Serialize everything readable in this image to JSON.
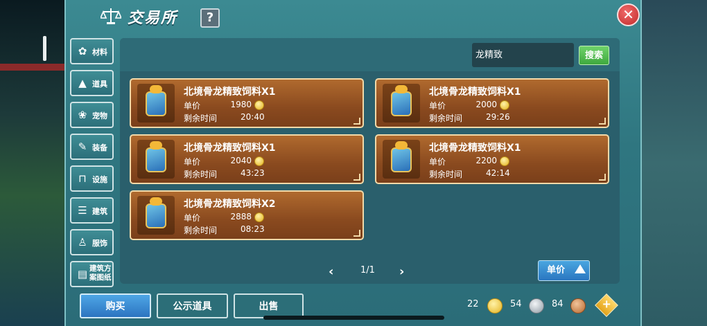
{
  "window": {
    "title": "交易所",
    "help_label": "?",
    "close_label": "✕"
  },
  "categories": [
    {
      "label": "材料",
      "icon": "materials-icon",
      "glyph": "✿"
    },
    {
      "label": "道具",
      "icon": "props-icon",
      "glyph": "▲"
    },
    {
      "label": "宠物",
      "icon": "pet-paw-icon",
      "glyph": "❀"
    },
    {
      "label": "装备",
      "icon": "equipment-icon",
      "glyph": "✎"
    },
    {
      "label": "设施",
      "icon": "facility-icon",
      "glyph": "⊓"
    },
    {
      "label": "建筑",
      "icon": "building-icon",
      "glyph": "☰"
    },
    {
      "label": "服饰",
      "icon": "clothing-icon",
      "glyph": "♙"
    },
    {
      "label": "建筑方案图纸",
      "icon": "blueprint-icon",
      "glyph": "▤"
    }
  ],
  "search": {
    "value": "龙精致",
    "button_label": "搜索"
  },
  "listings": [
    {
      "name": "北境骨龙精致饲料X1",
      "price_label": "单价",
      "price": "1980",
      "time_label": "剩余时间",
      "time": "20:40"
    },
    {
      "name": "北境骨龙精致饲料X1",
      "price_label": "单价",
      "price": "2000",
      "time_label": "剩余时间",
      "time": "29:26"
    },
    {
      "name": "北境骨龙精致饲料X1",
      "price_label": "单价",
      "price": "2040",
      "time_label": "剩余时间",
      "time": "43:23"
    },
    {
      "name": "北境骨龙精致饲料X1",
      "price_label": "单价",
      "price": "2200",
      "time_label": "剩余时间",
      "time": "42:14"
    },
    {
      "name": "北境骨龙精致饲料X2",
      "price_label": "单价",
      "price": "2888",
      "time_label": "剩余时间",
      "time": "08:23"
    }
  ],
  "pagination": {
    "label": "1/1",
    "prev": "‹",
    "next": "›"
  },
  "sort": {
    "label": "单价"
  },
  "bottom_tabs": {
    "buy": "购买",
    "public_items": "公示道具",
    "sell": "出售"
  },
  "currency": {
    "gold": "22",
    "silver": "54",
    "bronze": "84"
  },
  "colors": {
    "card": "#8a4a1f",
    "active_tab": "#2c74c0",
    "search_button": "#3ea83e",
    "close": "#c22a2a"
  }
}
